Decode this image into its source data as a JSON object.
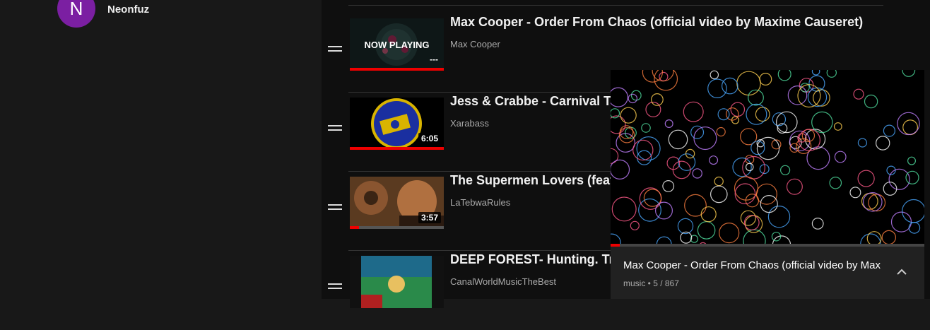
{
  "user": {
    "avatar_letter": "N",
    "name": "Neonfuz"
  },
  "playlist": {
    "items": [
      {
        "title": "Max Cooper - Order From Chaos (official video by Maxime Causeret)",
        "channel": "Max Cooper",
        "duration": "---",
        "overlay": "NOW PLAYING",
        "progress": 1.0
      },
      {
        "title": "Jess & Crabbe - Carnival Tim",
        "channel": "Xarabass",
        "duration": "6:05",
        "progress": 1.0
      },
      {
        "title": "The Supermen Lovers (feat.",
        "channel": "LaTebwaRules",
        "duration": "3:57",
        "progress": 0.1
      },
      {
        "title": "DEEP FOREST- Hunting. Trac",
        "channel": "CanalWorldMusicTheBest",
        "duration": "",
        "progress": 0
      }
    ]
  },
  "miniplayer": {
    "title": "Max Cooper - Order From Chaos (official video by Max",
    "meta": "music • 5 / 867",
    "progress": 0.03,
    "expand_icon": "chevron-up-icon"
  },
  "colors": {
    "accent": "#ee0000",
    "avatar": "#7b1fa2",
    "background": "#0f0f0f"
  }
}
